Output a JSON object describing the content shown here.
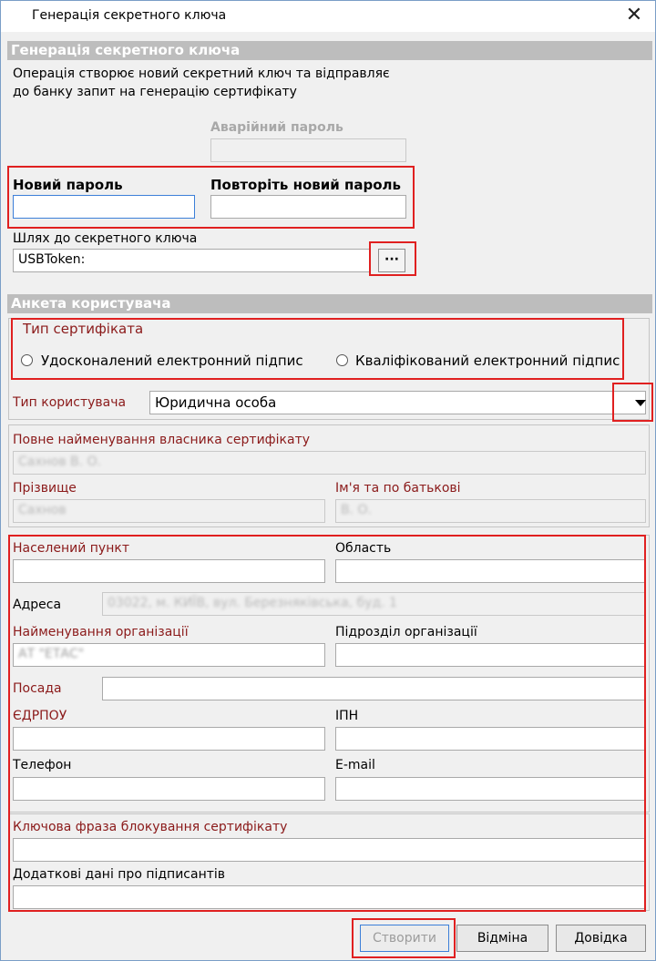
{
  "window": {
    "title": "Генерація секретного ключа",
    "close_glyph": "✕"
  },
  "key_section": {
    "header": "Генерація секретного ключа",
    "description_line1": "Операція створює новий секретний ключ та відправляє",
    "description_line2": "до банку запит на генерацію сертифікату",
    "emergency_password_label": "Аварійний пароль",
    "emergency_password_value": "",
    "new_password_label": "Новий пароль",
    "new_password_value": "",
    "repeat_password_label": "Повторіть новий пароль",
    "repeat_password_value": "",
    "key_path_label": "Шлях до секретного ключа",
    "key_path_value": "USBToken:",
    "browse_label": "···"
  },
  "user_form": {
    "header": "Анкета користувача",
    "cert_type_legend": "Тип сертифіката",
    "cert_type_options": [
      "Удосконалений електронний підпис",
      "Кваліфікований електронний підпис"
    ],
    "user_type_label": "Тип користувача",
    "user_type_value": "Юридична особа",
    "owner_full_name_label": "Повне найменування власника сертифікату",
    "owner_full_name_value": "Сахнов В. О.",
    "surname_label": "Прізвище",
    "surname_value": "Сахнов",
    "given_names_label": "Ім'я та по батькові",
    "given_names_value": "В. О.",
    "city_label": "Населений пункт",
    "city_value": "",
    "region_label": "Область",
    "region_value": "",
    "address_label": "Адреса",
    "address_value": "03022, м. КИЇВ, вул. Березняківська, буд. 1",
    "org_name_label": "Найменування організації",
    "org_name_value": "АТ \"ЕТАС\"",
    "org_unit_label": "Підрозділ організації",
    "org_unit_value": "",
    "position_label": "Посада",
    "position_value": "",
    "edrpou_label": "ЄДРПОУ",
    "edrpou_value": "",
    "ipn_label": "ІПН",
    "ipn_value": "",
    "phone_label": "Телефон",
    "phone_value": "",
    "email_label": "E-mail",
    "email_value": "",
    "block_phrase_label": "Ключова фраза блокування сертифікату",
    "block_phrase_value": "",
    "signers_info_label": "Додаткові дані про підписантів",
    "signers_info_value": ""
  },
  "buttons": {
    "create": "Створити",
    "cancel": "Відміна",
    "help": "Довідка"
  },
  "colors": {
    "highlight": "#e02020",
    "required_label": "#8b1a1a",
    "section_header": "#bdbdbd"
  }
}
